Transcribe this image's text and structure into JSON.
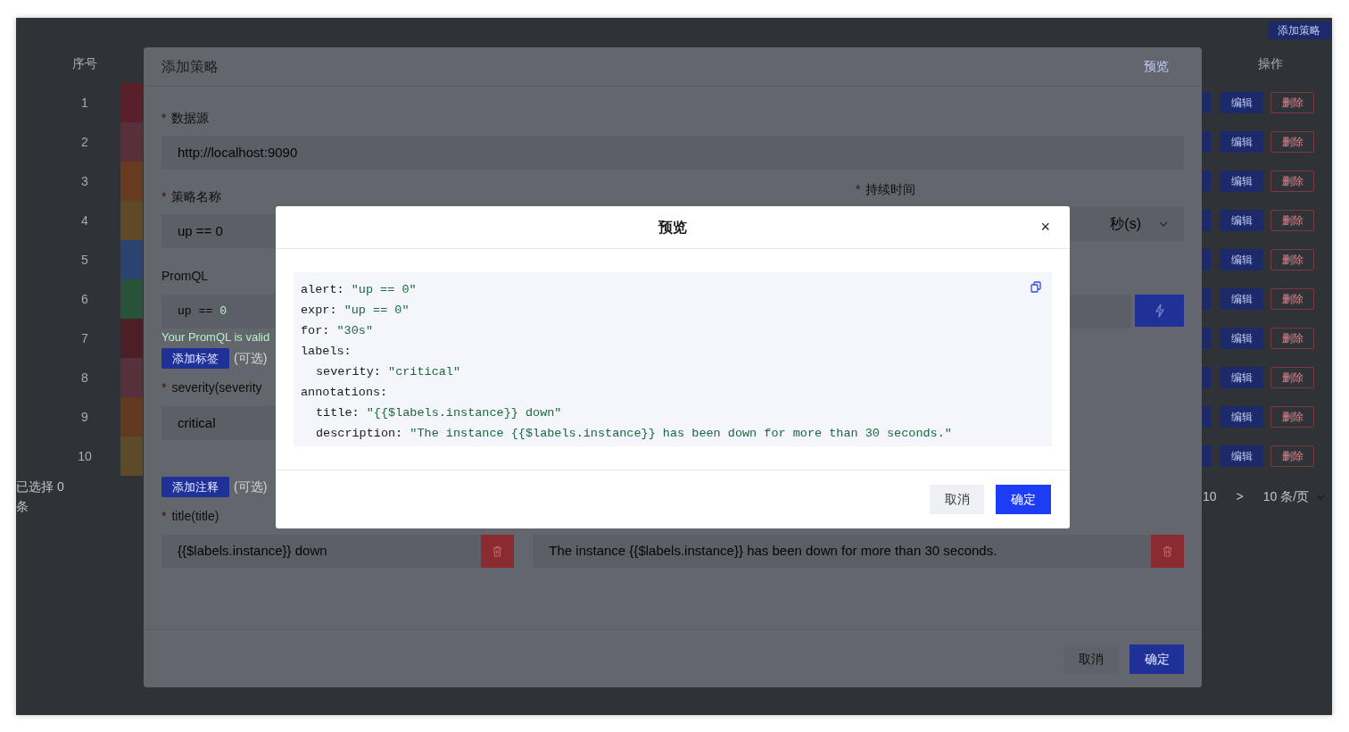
{
  "page": {
    "add_button": "添加策略",
    "columns": [
      "序号",
      "操作"
    ],
    "rows": [
      {
        "index": "1",
        "color": "#5a1f28",
        "edit": "编辑",
        "delete": "删除"
      },
      {
        "index": "2",
        "color": "#58303b",
        "edit": "编辑",
        "delete": "删除"
      },
      {
        "index": "3",
        "color": "#683b20",
        "edit": "编辑",
        "delete": "删除"
      },
      {
        "index": "4",
        "color": "#5e4a27",
        "edit": "编辑",
        "delete": "删除"
      },
      {
        "index": "5",
        "color": "#2c4371",
        "edit": "编辑",
        "delete": "删除"
      },
      {
        "index": "6",
        "color": "#285339",
        "edit": "编辑",
        "delete": "删除"
      },
      {
        "index": "7",
        "color": "#4d1e26",
        "edit": "编辑",
        "delete": "删除"
      },
      {
        "index": "8",
        "color": "#56303b",
        "edit": "编辑",
        "delete": "删除"
      },
      {
        "index": "9",
        "color": "#633a20",
        "edit": "编辑",
        "delete": "删除"
      },
      {
        "index": "10",
        "color": "#5d4a28",
        "edit": "编辑",
        "delete": "删除"
      }
    ],
    "selection": [
      "已选择 0",
      "条"
    ],
    "pagination": {
      "page": "10",
      "next": ">",
      "page_size": "10 条/页"
    }
  },
  "form_dialog": {
    "title": "添加策略",
    "preview_link": "预览",
    "datasource": {
      "mark": "*",
      "label": "数据源",
      "value": "http://localhost:9090"
    },
    "name": {
      "mark": "*",
      "label": "策略名称",
      "value": "up == 0"
    },
    "duration": {
      "mark": "*",
      "label": "持续时间",
      "unit": "秒(s)"
    },
    "promql": {
      "label": "PromQL",
      "tokens": [
        {
          "text": "up",
          "kind": "ident"
        },
        {
          "text": "==",
          "kind": "op"
        },
        {
          "text": "0",
          "kind": "number"
        }
      ],
      "status": "Your PromQL is valid"
    },
    "add_label_button": "添加标签",
    "label_optional": "(可选)",
    "labels": [
      {
        "mark": "*",
        "label": "severity(severity",
        "value": "critical"
      }
    ],
    "add_annotation_button": "添加注释",
    "annotation_optional": "(可选)",
    "annotations": [
      {
        "mark": "*",
        "label": "title(title)",
        "value": "{{$labels.instance}} down"
      },
      {
        "value": "The instance {{$labels.instance}} has been down for more than 30 seconds."
      }
    ],
    "cancel": "取消",
    "confirm": "确定"
  },
  "preview_dialog": {
    "title": "预览",
    "close": "×",
    "lines": [
      {
        "key": "alert:",
        "value": "\"up == 0\""
      },
      {
        "key": "expr:",
        "value": "\"up == 0\""
      },
      {
        "key": "for:",
        "value": "\"30s\""
      },
      {
        "key": "labels:",
        "children": [
          {
            "key": "severity:",
            "value": "\"critical\""
          }
        ]
      },
      {
        "key": "annotations:",
        "children": [
          {
            "key": "title:",
            "value": "\"{{$labels.instance}} down\""
          },
          {
            "key": "description:",
            "value": "\"The instance {{$labels.instance}} has been down for more than 30 seconds.\""
          }
        ]
      }
    ],
    "cancel": "取消",
    "confirm": "确定"
  }
}
